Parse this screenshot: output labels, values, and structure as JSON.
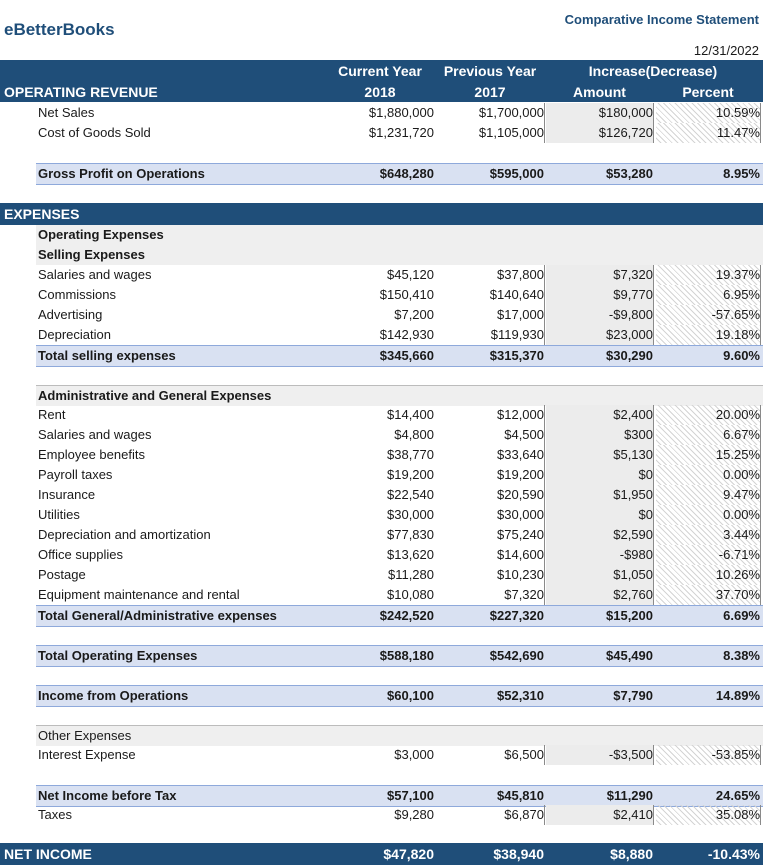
{
  "company": "eBetterBooks",
  "report_title": "Comparative Income Statement",
  "date": "12/31/2022",
  "header": {
    "current_year": "Current Year",
    "previous_year": "Previous Year",
    "increase": "Increase(Decrease)",
    "year_current": "2018",
    "year_previous": "2017",
    "amount": "Amount",
    "percent": "Percent",
    "section": "OPERATING REVENUE"
  },
  "revenue": [
    {
      "label": "Net Sales",
      "cur": "$1,880,000",
      "prev": "$1,700,000",
      "amt": "$180,000",
      "pct": "10.59%"
    },
    {
      "label": "Cost of Goods Sold",
      "cur": "$1,231,720",
      "prev": "$1,105,000",
      "amt": "$126,720",
      "pct": "11.47%"
    }
  ],
  "gross_profit": {
    "label": "Gross Profit on Operations",
    "cur": "$648,280",
    "prev": "$595,000",
    "amt": "$53,280",
    "pct": "8.95%"
  },
  "expenses_title": "EXPENSES",
  "operating_expenses_title": "Operating Expenses",
  "selling_title": "Selling Expenses",
  "selling": [
    {
      "label": "Salaries and wages",
      "cur": "$45,120",
      "prev": "$37,800",
      "amt": "$7,320",
      "pct": "19.37%"
    },
    {
      "label": "Commissions",
      "cur": "$150,410",
      "prev": "$140,640",
      "amt": "$9,770",
      "pct": "6.95%"
    },
    {
      "label": "Advertising",
      "cur": "$7,200",
      "prev": "$17,000",
      "amt": "-$9,800",
      "pct": "-57.65%"
    },
    {
      "label": "Depreciation",
      "cur": "$142,930",
      "prev": "$119,930",
      "amt": "$23,000",
      "pct": "19.18%"
    }
  ],
  "selling_total": {
    "label": "Total selling expenses",
    "cur": "$345,660",
    "prev": "$315,370",
    "amt": "$30,290",
    "pct": "9.60%"
  },
  "admin_title": "Administrative and General Expenses",
  "admin": [
    {
      "label": "Rent",
      "cur": "$14,400",
      "prev": "$12,000",
      "amt": "$2,400",
      "pct": "20.00%"
    },
    {
      "label": "Salaries and wages",
      "cur": "$4,800",
      "prev": "$4,500",
      "amt": "$300",
      "pct": "6.67%"
    },
    {
      "label": "Employee benefits",
      "cur": "$38,770",
      "prev": "$33,640",
      "amt": "$5,130",
      "pct": "15.25%"
    },
    {
      "label": "Payroll taxes",
      "cur": "$19,200",
      "prev": "$19,200",
      "amt": "$0",
      "pct": "0.00%"
    },
    {
      "label": "Insurance",
      "cur": "$22,540",
      "prev": "$20,590",
      "amt": "$1,950",
      "pct": "9.47%"
    },
    {
      "label": "Utilities",
      "cur": "$30,000",
      "prev": "$30,000",
      "amt": "$0",
      "pct": "0.00%"
    },
    {
      "label": "Depreciation and amortization",
      "cur": "$77,830",
      "prev": "$75,240",
      "amt": "$2,590",
      "pct": "3.44%"
    },
    {
      "label": "Office supplies",
      "cur": "$13,620",
      "prev": "$14,600",
      "amt": "-$980",
      "pct": "-6.71%"
    },
    {
      "label": "Postage",
      "cur": "$11,280",
      "prev": "$10,230",
      "amt": "$1,050",
      "pct": "10.26%"
    },
    {
      "label": "Equipment maintenance and rental",
      "cur": "$10,080",
      "prev": "$7,320",
      "amt": "$2,760",
      "pct": "37.70%"
    }
  ],
  "admin_total": {
    "label": "Total General/Administrative expenses",
    "cur": "$242,520",
    "prev": "$227,320",
    "amt": "$15,200",
    "pct": "6.69%"
  },
  "total_operating": {
    "label": "Total Operating Expenses",
    "cur": "$588,180",
    "prev": "$542,690",
    "amt": "$45,490",
    "pct": "8.38%"
  },
  "income_operations": {
    "label": "Income from Operations",
    "cur": "$60,100",
    "prev": "$52,310",
    "amt": "$7,790",
    "pct": "14.89%"
  },
  "other_title": "Other Expenses",
  "interest": {
    "label": "Interest Expense",
    "cur": "$3,000",
    "prev": "$6,500",
    "amt": "-$3,500",
    "pct": "-53.85%"
  },
  "net_before_tax": {
    "label": "Net Income before Tax",
    "cur": "$57,100",
    "prev": "$45,810",
    "amt": "$11,290",
    "pct": "24.65%"
  },
  "taxes": {
    "label": "Taxes",
    "cur": "$9,280",
    "prev": "$6,870",
    "amt": "$2,410",
    "pct": "35.08%"
  },
  "net_income": {
    "label": "NET INCOME",
    "cur": "$47,820",
    "prev": "$38,940",
    "amt": "$8,880",
    "pct": "-10.43%"
  }
}
